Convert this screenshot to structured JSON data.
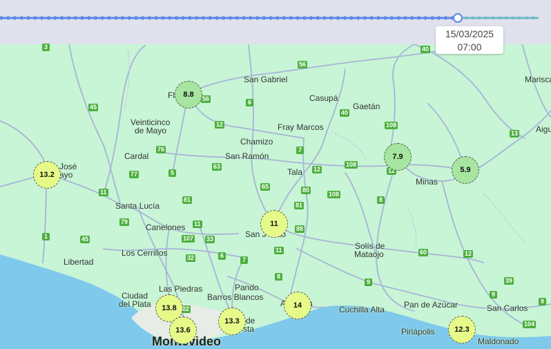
{
  "colors": {
    "land": "#c8f5d6",
    "water": "#7ec9ec",
    "road": "#a8b3d9",
    "timebar": "#dfe2ec",
    "slider_past": "#5b86e5",
    "slider_future": "#6fb8c8",
    "shield": "#4caf3e",
    "marker_yellow": "#e6fa8a",
    "marker_green": "#a6e6a0"
  },
  "timeline": {
    "date": "15/03/2025",
    "time": "07:00",
    "progress": 0.85
  },
  "markers": [
    {
      "value": "8.8",
      "tone": "green"
    },
    {
      "value": "13.2",
      "tone": "yellow"
    },
    {
      "value": "7.9",
      "tone": "green"
    },
    {
      "value": "5.9",
      "tone": "green"
    },
    {
      "value": "11",
      "tone": "yellow"
    },
    {
      "value": "13.8",
      "tone": "yellow"
    },
    {
      "value": "13.6",
      "tone": "yellow"
    },
    {
      "value": "13.3",
      "tone": "yellow"
    },
    {
      "value": "14",
      "tone": "yellow"
    },
    {
      "value": "12.3",
      "tone": "yellow"
    }
  ],
  "places": {
    "san_gabriel": "San Gabriel",
    "flores": "Fl",
    "casupa": "Casupá",
    "gaetan": "Gaetán",
    "mariscala": "Marisca",
    "aigua": "Aigu",
    "veinticinco_1": "Veinticinco",
    "veinticinco_2": "de Mayo",
    "fray_marcos": "Fray Marcos",
    "chamizo": "Chamizo",
    "cardal": "Cardal",
    "san_ramon": "San Ramón",
    "tala": "Tala",
    "minas": "Minas",
    "san_jose_1": "José",
    "san_jose_2": "ayo",
    "santa_lucia": "Santa Lucía",
    "canelones": "Canelones",
    "san_jacinto": "San J",
    "san_jacinto_end": "to",
    "solis_1": "Solís de",
    "solis_2": "Mataojo",
    "libertad": "Libertad",
    "los_cerrillos": "Los Cerrillos",
    "pando": "Pando",
    "las_piedras": "Las Piedras",
    "ciudad_1": "Ciudad",
    "ciudad_2": "del Plata",
    "barros_blancos": "Barros Blancos",
    "atlantida": "A",
    "atlantida_end": "a",
    "cuchilla_alta": "Cuchilla Alta",
    "pan_de_azucar": "Pan de Azúcar",
    "san_carlos": "San Carlos",
    "piriapolis": "Piriápolis",
    "maldonado": "Maldonado",
    "montevideo": "Montevideo",
    "ciudad_costa_1": "de",
    "ciudad_costa_2": "sta"
  },
  "road_shields": [
    "3",
    "40",
    "56",
    "56",
    "6",
    "12",
    "40",
    "108",
    "13",
    "76",
    "5",
    "7",
    "12",
    "108",
    "63",
    "65",
    "80",
    "108",
    "81",
    "11",
    "8",
    "77",
    "79",
    "11",
    "107",
    "33",
    "81",
    "88",
    "12",
    "1",
    "45",
    "45",
    "32",
    "6",
    "7",
    "11",
    "8",
    "60",
    "12",
    "9",
    "39",
    "9",
    "9",
    "104",
    "02"
  ]
}
